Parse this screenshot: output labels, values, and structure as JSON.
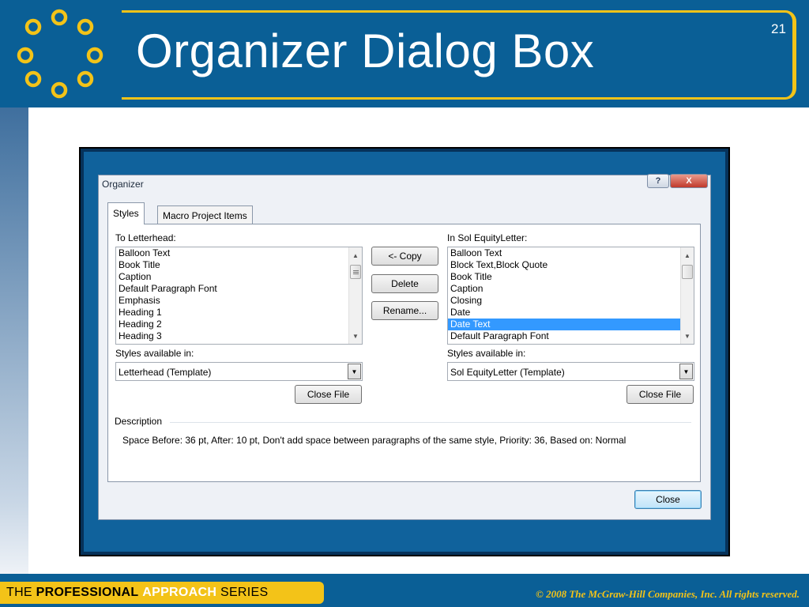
{
  "slide": {
    "title": "Organizer Dialog Box",
    "number": "21",
    "footer_the": "THE",
    "footer_professional": "PROFESSIONAL",
    "footer_approach": "APPROACH",
    "footer_series": "SERIES",
    "copyright": "© 2008 The McGraw-Hill Companies, Inc. All rights reserved."
  },
  "dialog": {
    "title": "Organizer",
    "help_label": "?",
    "close_label": "X",
    "tabs": [
      {
        "label": "Styles",
        "active": true
      },
      {
        "label": "Macro Project Items",
        "active": false
      }
    ],
    "left": {
      "label": "To Letterhead:",
      "items": [
        "Balloon Text",
        "Book Title",
        "Caption",
        "Default Paragraph Font",
        "Emphasis",
        "Heading 1",
        "Heading 2",
        "Heading 3"
      ],
      "available_label": "Styles available in:",
      "available_value": "Letterhead (Template)",
      "close_file_label": "Close File"
    },
    "right": {
      "label": "In Sol EquityLetter:",
      "items": [
        "Balloon Text",
        "Block Text,Block Quote",
        "Book Title",
        "Caption",
        "Closing",
        "Date",
        "Date Text",
        "Default Paragraph Font"
      ],
      "selected_index": 6,
      "available_label": "Styles available in:",
      "available_value": "Sol EquityLetter (Template)",
      "close_file_label": "Close File"
    },
    "buttons": {
      "copy": "<- Copy",
      "delete": "Delete",
      "rename": "Rename..."
    },
    "description_label": "Description",
    "description_text": "Space Before:  36 pt, After:  10 pt, Don't add space between paragraphs of the same style, Priority: 36, Based on: Normal",
    "close_button": "Close"
  },
  "colors": {
    "brand_blue": "#0a5f96",
    "brand_yellow": "#f3c318",
    "selection": "#3399ff"
  }
}
